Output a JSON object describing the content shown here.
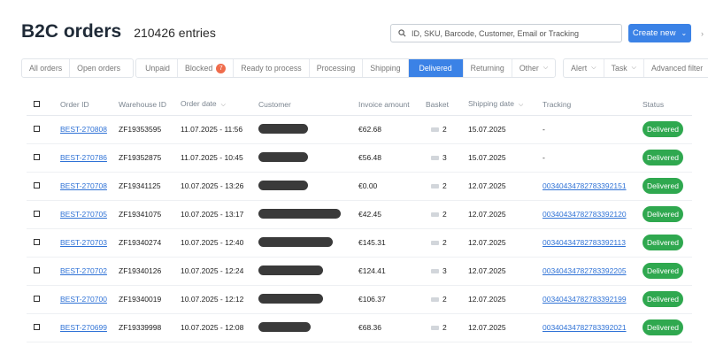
{
  "header": {
    "title": "B2C orders",
    "entries": "210426 entries"
  },
  "search": {
    "placeholder": "ID, SKU, Barcode, Customer, Email or Tracking"
  },
  "create": {
    "label": "Create new"
  },
  "tabs": {
    "g1": [
      "All orders",
      "Open orders"
    ],
    "g2": [
      {
        "label": "Unpaid"
      },
      {
        "label": "Blocked",
        "badge": "7"
      },
      {
        "label": "Ready to process"
      },
      {
        "label": "Processing"
      },
      {
        "label": "Shipping"
      },
      {
        "label": "Delivered"
      },
      {
        "label": "Returning"
      },
      {
        "label": "Other"
      }
    ],
    "g3": [
      "Alert",
      "Task",
      "Advanced filter"
    ]
  },
  "columns": [
    "Order ID",
    "Warehouse ID",
    "Order date",
    "Customer",
    "Invoice amount",
    "Basket",
    "Shipping date",
    "Tracking",
    "Status"
  ],
  "rows": [
    {
      "order_id": "BEST-270808",
      "warehouse": "ZF19353595",
      "date": "11.07.2025 - 11:56",
      "amount": "€62.68",
      "basket": "2",
      "ship": "15.07.2025",
      "tracking": "-",
      "status": "Delivered"
    },
    {
      "order_id": "BEST-270786",
      "warehouse": "ZF19352875",
      "date": "11.07.2025 - 10:45",
      "amount": "€56.48",
      "basket": "3",
      "ship": "15.07.2025",
      "tracking": "-",
      "status": "Delivered"
    },
    {
      "order_id": "BEST-270708",
      "warehouse": "ZF19341125",
      "date": "10.07.2025 - 13:26",
      "amount": "€0.00",
      "basket": "2",
      "ship": "12.07.2025",
      "tracking": "00340434782783392151",
      "status": "Delivered"
    },
    {
      "order_id": "BEST-270705",
      "warehouse": "ZF19341075",
      "date": "10.07.2025 - 13:17",
      "amount": "€42.45",
      "basket": "2",
      "ship": "12.07.2025",
      "tracking": "00340434782783392120",
      "status": "Delivered"
    },
    {
      "order_id": "BEST-270703",
      "warehouse": "ZF19340274",
      "date": "10.07.2025 - 12:40",
      "amount": "€145.31",
      "basket": "2",
      "ship": "12.07.2025",
      "tracking": "00340434782783392113",
      "status": "Delivered"
    },
    {
      "order_id": "BEST-270702",
      "warehouse": "ZF19340126",
      "date": "10.07.2025 - 12:24",
      "amount": "€124.41",
      "basket": "3",
      "ship": "12.07.2025",
      "tracking": "00340434782783392205",
      "status": "Delivered"
    },
    {
      "order_id": "BEST-270700",
      "warehouse": "ZF19340019",
      "date": "10.07.2025 - 12:12",
      "amount": "€106.37",
      "basket": "2",
      "ship": "12.07.2025",
      "tracking": "00340434782783392199",
      "status": "Delivered"
    },
    {
      "order_id": "BEST-270699",
      "warehouse": "ZF19339998",
      "date": "10.07.2025 - 12:08",
      "amount": "€68.36",
      "basket": "2",
      "ship": "12.07.2025",
      "tracking": "00340434782783392021",
      "status": "Delivered"
    }
  ],
  "colors": {
    "accent": "#3b82e6",
    "delivered": "#2fa84f",
    "badge": "#ef6c4c",
    "link": "#2f72d6"
  },
  "icons": {
    "search": "search-icon",
    "chevron": "chevron-down-icon",
    "basket": "basket-icon",
    "checkbox": "checkbox-icon"
  }
}
